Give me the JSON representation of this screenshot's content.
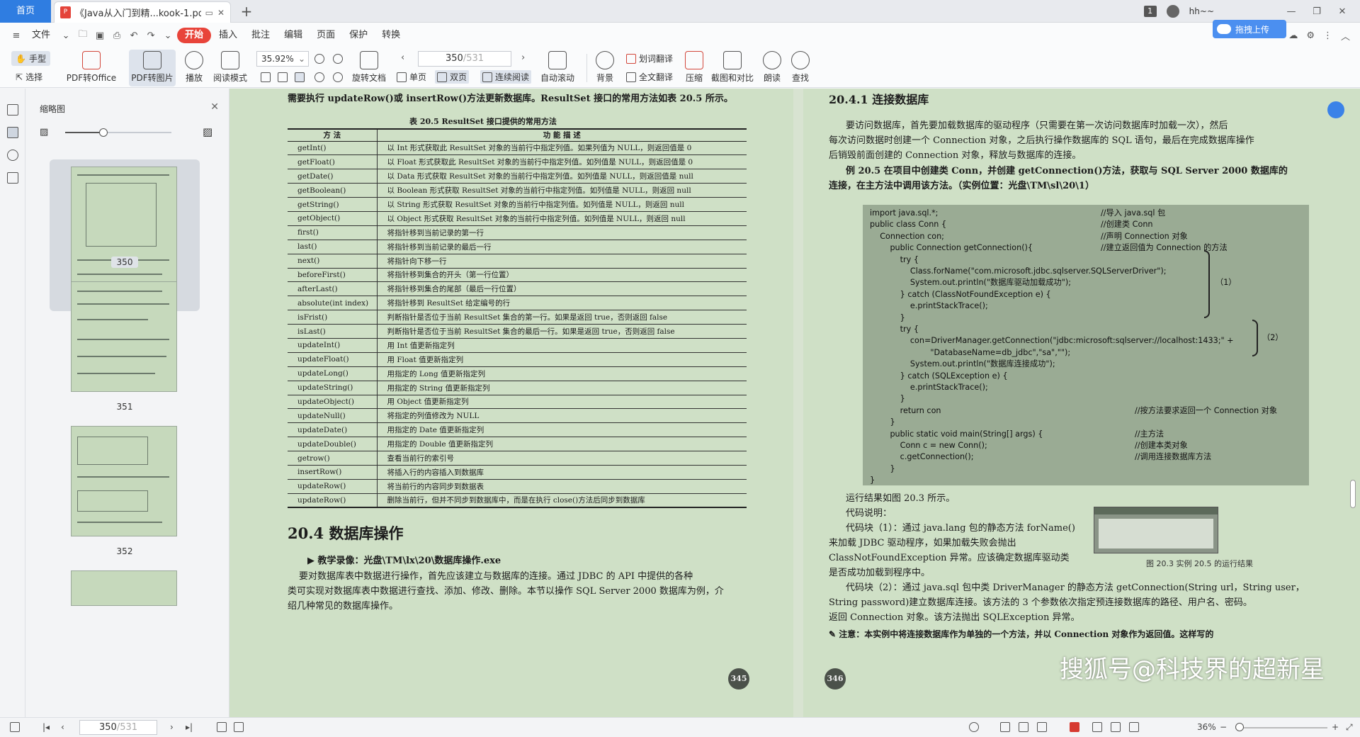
{
  "tabs": {
    "home": "首页",
    "doc_title": "《Java从入门到精...kook-1.pdf",
    "new_tab": "+"
  },
  "window": {
    "badge": "1",
    "user": "hh~~",
    "upload": "拖拽上传"
  },
  "menu": {
    "file": "文件",
    "items": [
      "开始",
      "插入",
      "批注",
      "编辑",
      "页面",
      "保护",
      "转换"
    ]
  },
  "ribbon": {
    "hand": "手型",
    "select": "选择",
    "pdf_to_office": "PDF转Office",
    "pdf_to_image": "PDF转图片",
    "play": "播放",
    "read_mode": "阅读模式",
    "zoom": "35.92%",
    "rotate": "旋转文档",
    "page_current": "350",
    "page_total": "/531",
    "single": "单页",
    "double": "双页",
    "continuous": "连续阅读",
    "auto_scroll": "自动滚动",
    "background": "背景",
    "word_translate": "划词翻译",
    "full_translate": "全文翻译",
    "compress": "压缩",
    "screenshot": "截图和对比",
    "read_aloud": "朗读",
    "find": "查找"
  },
  "thumbs": {
    "title": "缩略图",
    "pages": [
      "350",
      "351",
      "352"
    ]
  },
  "left_page": {
    "intro": "需要执行 updateRow()或 insertRow()方法更新数据库。ResultSet 接口的常用方法如表 20.5 所示。",
    "table_title": "表 20.5    ResultSet 接口提供的常用方法",
    "table_headers": [
      "方    法",
      "功 能 描 述"
    ],
    "table_rows": [
      [
        "getInt()",
        "以 Int 形式获取此 ResultSet 对象的当前行中指定列值。如果列值为 NULL，则返回值是 0"
      ],
      [
        "getFloat()",
        "以 Float 形式获取此 ResultSet 对象的当前行中指定列值。如列值是 NULL，则返回值是 0"
      ],
      [
        "getDate()",
        "以 Data 形式获取 ResultSet 对象的当前行中指定列值。如列值是 NULL，则返回值是 null"
      ],
      [
        "getBoolean()",
        "以 Boolean 形式获取 ResultSet 对象的当前行中指定列值。如列值是 NULL，则返回 null"
      ],
      [
        "getString()",
        "以 String 形式获取 ResultSet 对象的当前行中指定列值。如列值是 NULL，则返回 null"
      ],
      [
        "getObject()",
        "以 Object 形式获取 ResultSet 对象的当前行中指定列值。如列值是 NULL，则返回 null"
      ],
      [
        "first()",
        "将指针移到当前记录的第一行"
      ],
      [
        "last()",
        "将指针移到当前记录的最后一行"
      ],
      [
        "next()",
        "将指针向下移一行"
      ],
      [
        "beforeFirst()",
        "将指针移到集合的开头（第一行位置）"
      ],
      [
        "afterLast()",
        "将指针移到集合的尾部（最后一行位置）"
      ],
      [
        "absolute(int index)",
        "将指针移到 ResultSet 给定编号的行"
      ],
      [
        "isFrist()",
        "判断指针是否位于当前 ResultSet 集合的第一行。如果是返回 true，否则返回 false"
      ],
      [
        "isLast()",
        "判断指针是否位于当前 ResultSet 集合的最后一行。如果是返回 true，否则返回 false"
      ],
      [
        "updateInt()",
        "用 Int 值更新指定列"
      ],
      [
        "updateFloat()",
        "用 Float 值更新指定列"
      ],
      [
        "updateLong()",
        "用指定的 Long 值更新指定列"
      ],
      [
        "updateString()",
        "用指定的 String 值更新指定列"
      ],
      [
        "updateObject()",
        "用 Object 值更新指定列"
      ],
      [
        "updateNull()",
        "将指定的列值修改为 NULL"
      ],
      [
        "updateDate()",
        "用指定的 Date 值更新指定列"
      ],
      [
        "updateDouble()",
        "用指定的 Double 值更新指定列"
      ],
      [
        "getrow()",
        "查看当前行的索引号"
      ],
      [
        "insertRow()",
        "将插入行的内容插入到数据库"
      ],
      [
        "updateRow()",
        "将当前行的内容同步到数据表"
      ],
      [
        "updateRow()",
        "删除当前行，但并不同步到数据库中，而是在执行 close()方法后同步到数据库"
      ]
    ],
    "section": "20.4    数据库操作",
    "video": "教学录像：光盘\\TM\\lx\\20\\数据库操作.exe",
    "para": [
      "要对数据库表中数据进行操作，首先应该建立与数据库的连接。通过 JDBC 的 API 中提供的各种",
      "类可实现对数据库表中数据进行查找、添加、修改、删除。本节以操作 SQL Server 2000 数据库为例，介",
      "绍几种常见的数据库操作。"
    ],
    "page_no": "345"
  },
  "right_page": {
    "section": "20.4.1    连接数据库",
    "para1": [
      "要访问数据库，首先要加载数据库的驱动程序（只需要在第一次访问数据库时加载一次），然后",
      "每次访问数据时创建一个 Connection 对象，之后执行操作数据库的 SQL 语句，最后在完成数据库操作",
      "后销毁前面创建的 Connection 对象，释放与数据库的连接。"
    ],
    "example": [
      "例 20.5    在项目中创建类 Conn，并创建 getConnection()方法，获取与 SQL Server 2000 数据库的",
      "连接，在主方法中调用该方法。（实例位置：光盘\\TM\\sl\\20\\1）"
    ],
    "code": [
      "import java.sql.*;",
      "public class Conn {",
      "    Connection con;",
      "        public Connection getConnection(){",
      "            try {",
      "                Class.forName(\"com.microsoft.jdbc.sqlserver.SQLServerDriver\");",
      "                System.out.println(\"数据库驱动加载成功\");",
      "            } catch (ClassNotFoundException e) {",
      "                e.printStackTrace();",
      "            }",
      "            try {",
      "                con=DriverManager.getConnection(\"jdbc:microsoft:sqlserver://localhost:1433;\" +",
      "                        \"DatabaseName=db_jdbc\",\"sa\",\"\");",
      "                System.out.println(\"数据库连接成功\");",
      "            } catch (SQLException e) {",
      "                e.printStackTrace();",
      "            }",
      "            return con",
      "        }",
      "        public static void main(String[] args) {",
      "            Conn c = new Conn();",
      "            c.getConnection();",
      "        }",
      "}"
    ],
    "code_comments": [
      "//导入 java.sql 包",
      "//创建类 Conn",
      "//声明 Connection 对象",
      "//建立返回值为 Connection 的方法",
      "",
      "",
      "",
      "",
      "",
      "",
      "",
      "",
      "",
      "",
      "",
      "",
      "",
      "//按方法要求返回一个 Connection 对象",
      "",
      "//主方法",
      "//创建本类对象",
      "//调用连接数据库方法",
      "",
      ""
    ],
    "brace1": "（1）",
    "brace2": "（2）",
    "after": [
      "运行结果如图 20.3 所示。",
      "代码说明：",
      "代码块（1）：通过 java.lang 包的静态方法 forName()",
      "来加载 JDBC 驱动程序，如果加载失败会抛出",
      "ClassNotFoundException 异常。应该确定数据库驱动类",
      "是否成功加载到程序中。",
      "代码块（2）：通过 java.sql 包中类 DriverManager 的静态方法 getConnection(String url，String user，",
      "String password)建立数据库连接。该方法的 3 个参数依次指定预连接数据库的路径、用户名、密码。",
      "返回 Connection 对象。该方法抛出 SQLException 异常。"
    ],
    "fig_caption": "图 20.3    实例 20.5 的运行结果",
    "note": "注意：本实例中将连接数据库作为单独的一个方法，并以 Connection 对象作为返回值。这样写的",
    "page_no": "346"
  },
  "watermark": "搜狐号@科技界的超新星",
  "status": {
    "page_current": "350",
    "page_total": "/531",
    "zoom": "36%"
  }
}
